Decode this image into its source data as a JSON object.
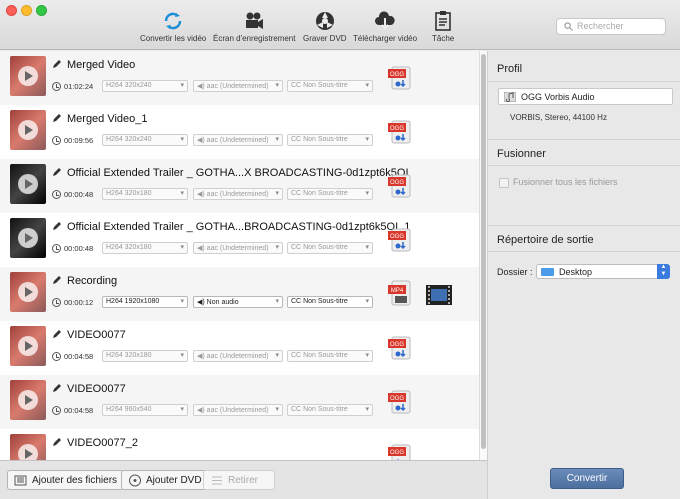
{
  "toolbar": {
    "buttons": [
      {
        "label": "Convertir les vidéo",
        "icon": "convert-icon"
      },
      {
        "label": "Écran d'enregistrement",
        "icon": "camera-icon"
      },
      {
        "label": "Graver DVD",
        "icon": "burn-icon"
      },
      {
        "label": "Télécharger vidéo",
        "icon": "download-icon"
      },
      {
        "label": "Tâche",
        "icon": "task-icon"
      }
    ],
    "search_placeholder": "Rechercher"
  },
  "files": [
    {
      "title": "Merged Video",
      "duration": "01:02:24",
      "video": "H264 320x240",
      "audio": "aac (Undetermined)",
      "subtitle": "Non Sous-titre",
      "format": "OGG",
      "active": false
    },
    {
      "title": "Merged Video_1",
      "duration": "00:09:56",
      "video": "H264 320x240",
      "audio": "aac (Undetermined)",
      "subtitle": "Non Sous-titre",
      "format": "OGG",
      "active": false
    },
    {
      "title": "Official Extended Trailer _ GOTHA...X BROADCASTING-0d1zpt6k5OI",
      "duration": "00:00:48",
      "video": "H264 320x180",
      "audio": "aac (Undetermined)",
      "subtitle": "Non Sous-titre",
      "format": "OGG",
      "active": false
    },
    {
      "title": "Official Extended Trailer _ GOTHA...BROADCASTING-0d1zpt6k5OI_1",
      "duration": "00:00:48",
      "video": "H264 320x180",
      "audio": "aac (Undetermined)",
      "subtitle": "Non Sous-titre",
      "format": "OGG",
      "active": false
    },
    {
      "title": "Recording",
      "duration": "00:00:12",
      "video": "H264 1920x1080",
      "audio": "Non audio",
      "subtitle": "Non Sous-titre",
      "format": "MP4",
      "active": true
    },
    {
      "title": "VIDEO0077",
      "duration": "00:04:58",
      "video": "H264 320x180",
      "audio": "aac (Undetermined)",
      "subtitle": "Non Sous-titre",
      "format": "OGG",
      "active": false
    },
    {
      "title": "VIDEO0077",
      "duration": "00:04:58",
      "video": "H264 960x540",
      "audio": "aac (Undetermined)",
      "subtitle": "Non Sous-titre",
      "format": "OGG",
      "active": false
    },
    {
      "title": "VIDEO0077_2",
      "duration": "",
      "video": "",
      "audio": "",
      "subtitle": "",
      "format": "OGG",
      "active": false
    }
  ],
  "bottom": {
    "add_files": "Ajouter des fichiers",
    "add_dvd": "Ajouter DVD",
    "remove": "Retirer",
    "convert": "Convertir"
  },
  "panel": {
    "profile_title": "Profil",
    "profile_value": "OGG Vorbis Audio",
    "profile_desc": "VORBIS, Stereo, 44100 Hz",
    "merge_title": "Fusionner",
    "merge_label": "Fusionner tous les fichiers",
    "output_title": "Répertoire de sortie",
    "folder_label": "Dossier :",
    "folder_value": "Desktop"
  },
  "colors": {
    "accent": "#3a7be0",
    "convert": "#4d6f9f",
    "ogg_red": "#d9372b"
  }
}
